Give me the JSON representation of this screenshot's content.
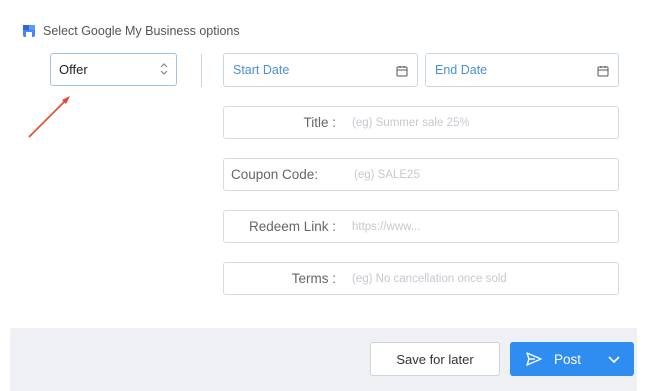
{
  "header": {
    "label": "Select Google My Business options",
    "icon": "google-my-business-icon"
  },
  "post_type": {
    "selected": "Offer"
  },
  "dates": {
    "start_placeholder": "Start Date",
    "end_placeholder": "End Date"
  },
  "fields": {
    "title": {
      "label": "Title :",
      "placeholder": "(eg) Summer sale 25%"
    },
    "coupon": {
      "label": "Coupon Code:",
      "placeholder": "(eg) SALE25"
    },
    "redeem": {
      "label": "Redeem Link :",
      "placeholder": "https://www..."
    },
    "terms": {
      "label": "Terms :",
      "placeholder": "(eg) No cancellation once sold"
    }
  },
  "footer": {
    "save_label": "Save for later",
    "post_label": "Post"
  },
  "colors": {
    "accent": "#2f8cf0",
    "annotation_arrow": "#e8452c"
  }
}
